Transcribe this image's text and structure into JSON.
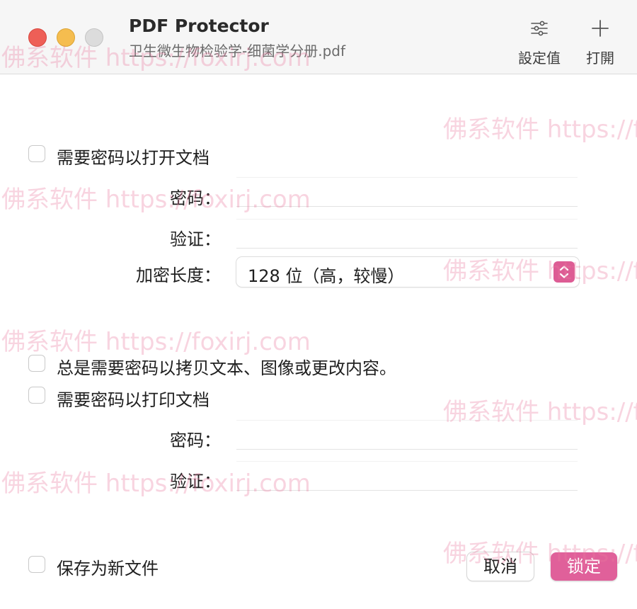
{
  "titlebar": {
    "app_title": "PDF Protector",
    "document_name": "卫生微生物检验学-细菌学分册.pdf",
    "settings_label": "設定值",
    "open_label": "打開",
    "settings_icon": "sliders-icon",
    "open_icon": "plus-icon"
  },
  "open_protection": {
    "checkbox_label": "需要密码以打开文档",
    "checked": false,
    "password_label": "密码：",
    "password_value": "",
    "verify_label": "验证：",
    "verify_value": "",
    "key_length_label": "加密长度：",
    "key_length_value": "128 位（高，较慢）"
  },
  "copy_protection": {
    "checkbox_label": "总是需要密码以拷贝文本、图像或更改内容。",
    "checked": false
  },
  "print_protection": {
    "checkbox_label": "需要密码以打印文档",
    "checked": false,
    "password_label": "密码：",
    "password_value": "",
    "verify_label": "验证：",
    "verify_value": ""
  },
  "footer": {
    "save_as_new_label": "保存为新文件",
    "save_as_new_checked": false,
    "cancel_label": "取消",
    "lock_label": "锁定"
  },
  "watermark": {
    "text": "佛系软件 https://foxirj.com"
  },
  "colors": {
    "accent": "#e0609a",
    "close": "#ee5f57",
    "minimize": "#f5bd4f",
    "zoom_inactive": "#dcdcdc"
  }
}
